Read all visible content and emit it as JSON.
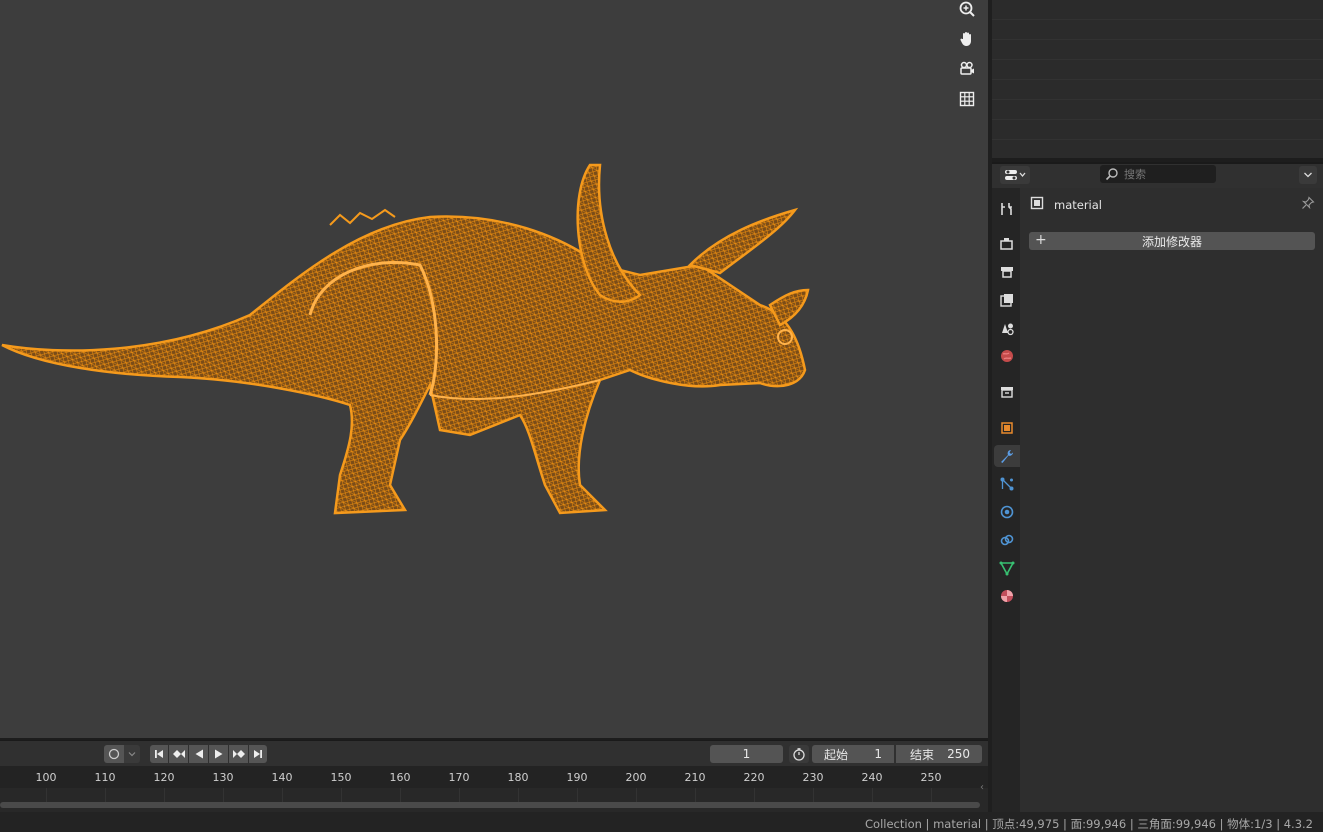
{
  "viewport": {
    "gizmos": [
      "zoom-icon",
      "hand-icon",
      "camera-icon",
      "grid-icon"
    ],
    "object_color": "#f0900f",
    "background_color": "#3d3d3d"
  },
  "timeline": {
    "current_frame": "1",
    "start_label": "起始",
    "start_value": "1",
    "end_label": "结束",
    "end_value": "250",
    "ticks": [
      "100",
      "110",
      "120",
      "130",
      "140",
      "150",
      "160",
      "170",
      "180",
      "190",
      "200",
      "210",
      "220",
      "230",
      "240",
      "250"
    ]
  },
  "properties": {
    "search_placeholder": "搜索",
    "object_name": "material",
    "add_modifier_label": "添加修改器",
    "active_tab": "modifier-tab"
  },
  "status_bar": {
    "text": "Collection | material | 顶点:49,975 | 面:99,946 | 三角面:99,946 | 物体:1/3 | 4.3.2"
  }
}
